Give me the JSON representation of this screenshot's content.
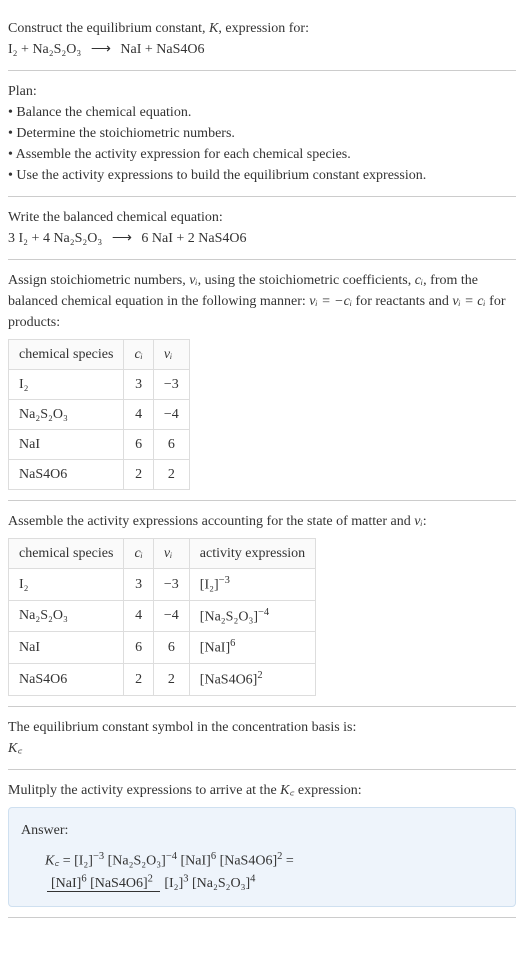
{
  "intro": {
    "line1": "Construct the equilibrium constant, ",
    "K": "K",
    "line1b": ", expression for:",
    "eq_left": "I₂ + Na₂S₂O₃",
    "arrow": "⟶",
    "eq_right": "NaI + NaS4O6"
  },
  "plan": {
    "title": "Plan:",
    "b1": "• Balance the chemical equation.",
    "b2": "• Determine the stoichiometric numbers.",
    "b3": "• Assemble the activity expression for each chemical species.",
    "b4": "• Use the activity expressions to build the equilibrium constant expression."
  },
  "balanced": {
    "title": "Write the balanced chemical equation:",
    "left": "3 I₂ + 4 Na₂S₂O₃",
    "arrow": "⟶",
    "right": "6 NaI + 2 NaS4O6"
  },
  "assign": {
    "text1": "Assign stoichiometric numbers, ",
    "nu": "νᵢ",
    "text2": ", using the stoichiometric coefficients, ",
    "ci": "cᵢ",
    "text3": ", from the balanced chemical equation in the following manner: ",
    "rel1": "νᵢ = −cᵢ",
    "text4": " for reactants and ",
    "rel2": "νᵢ = cᵢ",
    "text5": " for products:",
    "headers": {
      "h1": "chemical species",
      "h2": "cᵢ",
      "h3": "νᵢ"
    },
    "rows": [
      {
        "sp": "I₂",
        "c": "3",
        "v": "−3"
      },
      {
        "sp": "Na₂S₂O₃",
        "c": "4",
        "v": "−4"
      },
      {
        "sp": "NaI",
        "c": "6",
        "v": "6"
      },
      {
        "sp": "NaS4O6",
        "c": "2",
        "v": "2"
      }
    ]
  },
  "activity": {
    "title1": "Assemble the activity expressions accounting for the state of matter and ",
    "nu": "νᵢ",
    "title2": ":",
    "headers": {
      "h1": "chemical species",
      "h2": "cᵢ",
      "h3": "νᵢ",
      "h4": "activity expression"
    },
    "rows": [
      {
        "sp": "I₂",
        "c": "3",
        "v": "−3",
        "base": "[I₂]",
        "exp": "−3"
      },
      {
        "sp": "Na₂S₂O₃",
        "c": "4",
        "v": "−4",
        "base": "[Na₂S₂O₃]",
        "exp": "−4"
      },
      {
        "sp": "NaI",
        "c": "6",
        "v": "6",
        "base": "[NaI]",
        "exp": "6"
      },
      {
        "sp": "NaS4O6",
        "c": "2",
        "v": "2",
        "base": "[NaS4O6]",
        "exp": "2"
      }
    ]
  },
  "symbol": {
    "line1": "The equilibrium constant symbol in the concentration basis is:",
    "Kc": "K꜀"
  },
  "multiply": {
    "line": "Mulitply the activity expressions to arrive at the ",
    "Kc": "K꜀",
    "line2": " expression:"
  },
  "answer": {
    "label": "Answer:",
    "Kc": "K꜀",
    "eq": " = ",
    "t1b": "[I₂]",
    "t1e": "−3",
    "t2b": "[Na₂S₂O₃]",
    "t2e": "−4",
    "t3b": "[NaI]",
    "t3e": "6",
    "t4b": "[NaS4O6]",
    "t4e": "2",
    "eq2": " = ",
    "n1b": "[NaI]",
    "n1e": "6",
    "n2b": "[NaS4O6]",
    "n2e": "2",
    "d1b": "[I₂]",
    "d1e": "3",
    "d2b": "[Na₂S₂O₃]",
    "d2e": "4"
  }
}
